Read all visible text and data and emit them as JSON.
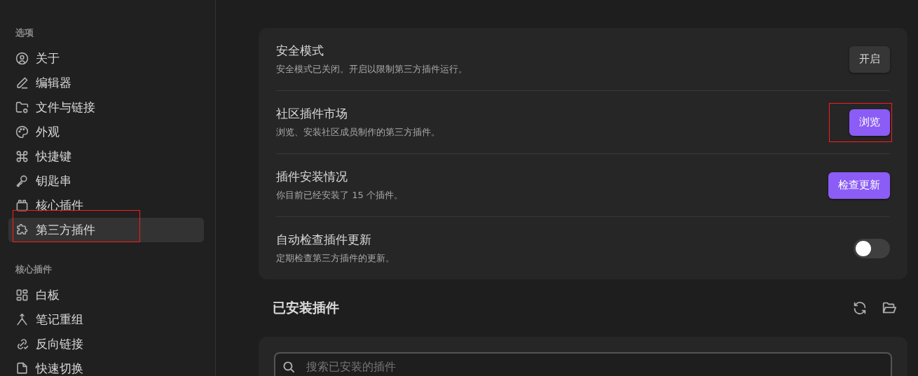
{
  "sidebar": {
    "sections": [
      {
        "title": "选项",
        "items": [
          {
            "label": "关于",
            "selected": false,
            "annotated": false
          },
          {
            "label": "编辑器",
            "selected": false,
            "annotated": false
          },
          {
            "label": "文件与链接",
            "selected": false,
            "annotated": false
          },
          {
            "label": "外观",
            "selected": false,
            "annotated": false
          },
          {
            "label": "快捷键",
            "selected": false,
            "annotated": false
          },
          {
            "label": "钥匙串",
            "selected": false,
            "annotated": false
          },
          {
            "label": "核心插件",
            "selected": false,
            "annotated": false
          },
          {
            "label": "第三方插件",
            "selected": true,
            "annotated": true
          }
        ]
      },
      {
        "title": "核心插件",
        "items": [
          {
            "label": "白板",
            "selected": false,
            "annotated": false
          },
          {
            "label": "笔记重组",
            "selected": false,
            "annotated": false
          },
          {
            "label": "反向链接",
            "selected": false,
            "annotated": false
          },
          {
            "label": "快速切换",
            "selected": false,
            "annotated": false
          }
        ]
      }
    ]
  },
  "settings": [
    {
      "title": "安全模式",
      "description": "安全模式已关闭。开启以限制第三方插件运行。",
      "kind": "button",
      "button": {
        "label": "开启",
        "primary": false,
        "annotated": false
      }
    },
    {
      "title": "社区插件市场",
      "description": "浏览、安装社区成员制作的第三方插件。",
      "kind": "button",
      "button": {
        "label": "浏览",
        "primary": true,
        "annotated": true
      }
    },
    {
      "title": "插件安装情况",
      "description": "你目前已经安装了 15 个插件。",
      "kind": "button",
      "button": {
        "label": "检查更新",
        "primary": true,
        "annotated": false
      }
    },
    {
      "title": "自动检查插件更新",
      "description": "定期检查第三方插件的更新。",
      "kind": "toggle",
      "on": false
    }
  ],
  "installed": {
    "heading": "已安装插件",
    "search": {
      "placeholder": "搜索已安装的插件"
    }
  }
}
